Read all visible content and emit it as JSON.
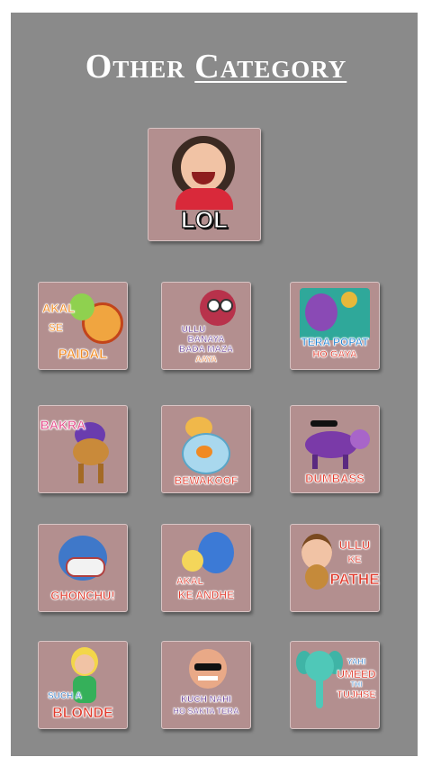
{
  "title": {
    "first": "Other",
    "second": "Category"
  },
  "featured": {
    "label": "LOL"
  },
  "stickers": [
    {
      "id": "akal-se-paidal",
      "lines": [
        "AKAL",
        "SE",
        "PAIDAL"
      ]
    },
    {
      "id": "ullu-banaya",
      "lines": [
        "ULLU",
        "BANAYA",
        "BADA MAZA",
        "AAYA"
      ]
    },
    {
      "id": "tera-popat",
      "lines": [
        "TERA POPAT",
        "HO GAYA"
      ]
    },
    {
      "id": "bakra",
      "lines": [
        "BAKRA"
      ]
    },
    {
      "id": "bewakoof",
      "lines": [
        "BEWAKOOF"
      ]
    },
    {
      "id": "dumbass",
      "lines": [
        "DUMBASS"
      ]
    },
    {
      "id": "ghonchu",
      "lines": [
        "GHONCHU!"
      ]
    },
    {
      "id": "akal-ke-andhe",
      "lines": [
        "AKAL",
        "KE ANDHE"
      ]
    },
    {
      "id": "ullu-ke-pathe",
      "lines": [
        "ULLU",
        "KE",
        "PATHE"
      ]
    },
    {
      "id": "such-a-blonde",
      "lines": [
        "SUCH A",
        "BLONDE"
      ]
    },
    {
      "id": "kuch-nahi",
      "lines": [
        "KUCH NAHI",
        "HO SAKTA TERA"
      ]
    },
    {
      "id": "yahi-umeed",
      "lines": [
        "YAHI",
        "UMEED",
        "THI",
        "TUJHSE"
      ]
    }
  ]
}
